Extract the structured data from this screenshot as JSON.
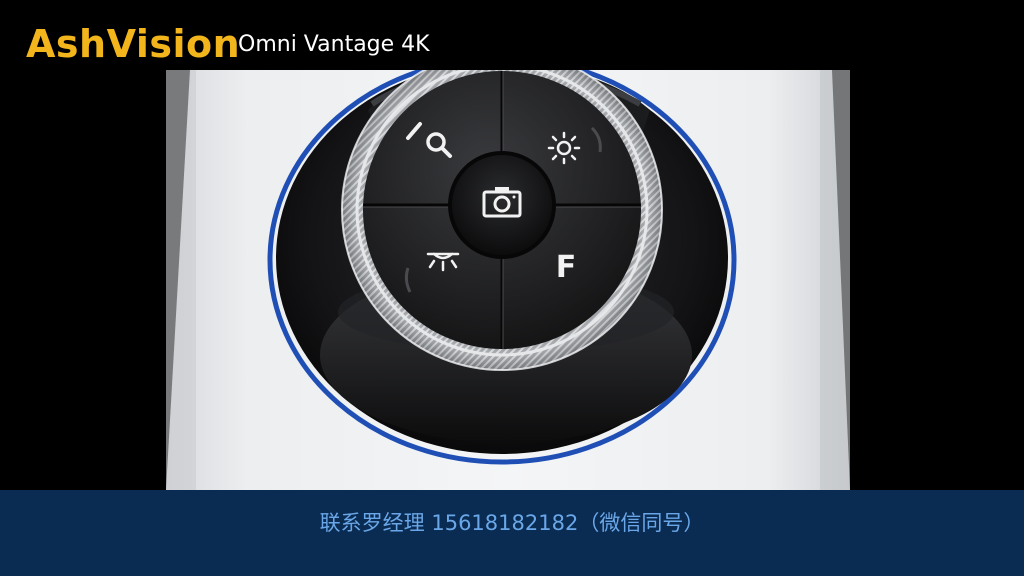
{
  "header": {
    "brand": "AshVision",
    "model": "Omni Vantage 4K"
  },
  "footer": {
    "contact": "联系罗经理 15618182182（微信同号）"
  },
  "device": {
    "buttons": {
      "zoom": {
        "icon": "zoom-icon"
      },
      "brightness": {
        "icon": "brightness-icon"
      },
      "camera": {
        "icon": "camera-icon"
      },
      "light": {
        "icon": "light-icon"
      },
      "focus": {
        "icon": "focus-icon",
        "label": "F"
      }
    }
  },
  "colors": {
    "brand": "#f2b51c",
    "accent_ring": "#1f4fb5",
    "footer_bg": "#0a2b52",
    "footer_text": "#6aa7e8"
  }
}
